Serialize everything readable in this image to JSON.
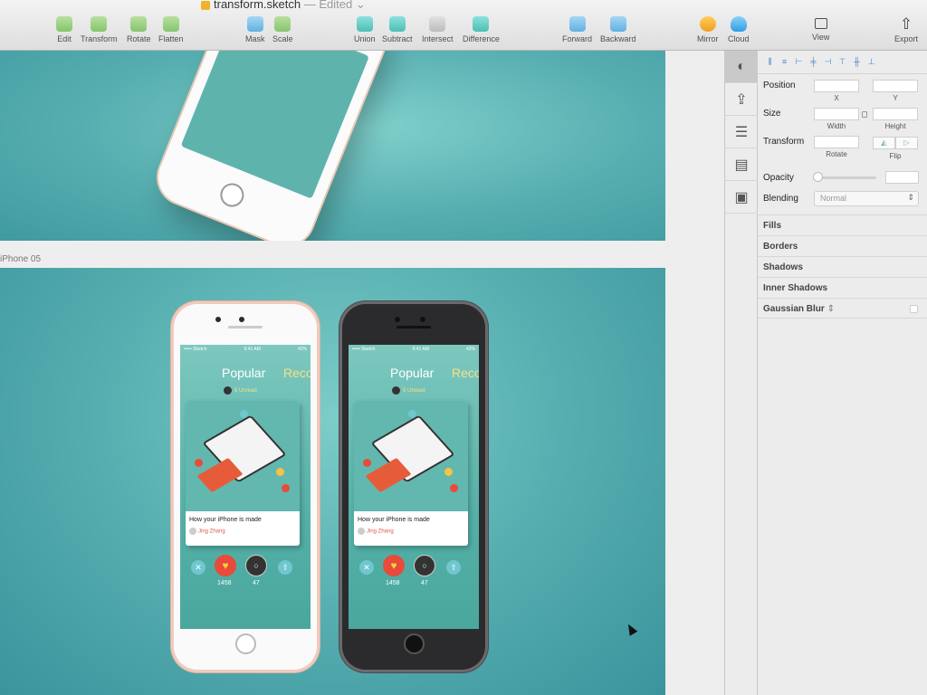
{
  "window": {
    "title": "transform.sketch",
    "status": "— Edited"
  },
  "toolbar": {
    "edit": "Edit",
    "transform": "Transform",
    "rotate": "Rotate",
    "flatten": "Flatten",
    "mask": "Mask",
    "scale": "Scale",
    "union": "Union",
    "subtract": "Subtract",
    "intersect": "Intersect",
    "difference": "Difference",
    "forward": "Forward",
    "backward": "Backward",
    "mirror": "Mirror",
    "cloud": "Cloud",
    "view": "View",
    "export": "Export"
  },
  "canvas": {
    "artboard_label": "iPhone 05",
    "phone_screen": {
      "carrier": "••••• Sketch",
      "time": "9:41 AM",
      "battery": "42%",
      "tab_active": "Popular",
      "tab_next": "Reco",
      "unread": "5 Unread",
      "card_title": "How your iPhone is made",
      "card_author": "Jing Zhang",
      "likes": "1458",
      "comments": "47"
    }
  },
  "inspector": {
    "position_label": "Position",
    "x_label": "X",
    "y_label": "Y",
    "size_label": "Size",
    "width_label": "Width",
    "height_label": "Height",
    "transform_label": "Transform",
    "rotate_label": "Rotate",
    "flip_label": "Flip",
    "opacity_label": "Opacity",
    "blending_label": "Blending",
    "blending_value": "Normal",
    "sections": [
      "Fills",
      "Borders",
      "Shadows",
      "Inner Shadows",
      "Gaussian Blur"
    ]
  }
}
